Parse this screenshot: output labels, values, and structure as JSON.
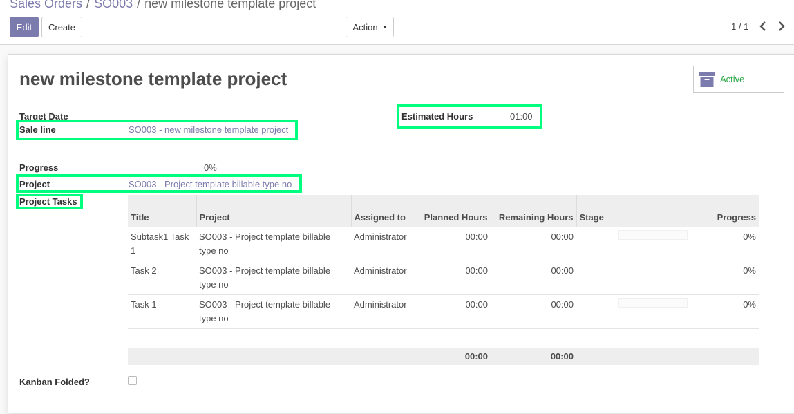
{
  "breadcrumb": {
    "items": [
      "Sales Orders",
      "SO003",
      "new milestone template project"
    ],
    "separator": "/"
  },
  "toolbar": {
    "edit_label": "Edit",
    "create_label": "Create",
    "action_label": "Action",
    "pager": "1 / 1"
  },
  "record": {
    "title": "new milestone template project",
    "status_button": "Active",
    "target_date_label": "Target Date",
    "sale_line_label": "Sale line",
    "sale_line_value": "SO003 - new milestone template project",
    "estimated_hours_label": "Estimated Hours",
    "estimated_hours_value": "01:00",
    "progress_label": "Progress",
    "progress_value": "0%",
    "project_label": "Project",
    "project_value": "SO003 - Project template billable type no",
    "project_tasks_label": "Project Tasks",
    "kanban_folded_label": "Kanban Folded?",
    "kanban_folded_checked": false
  },
  "tasks_table": {
    "headers": {
      "title": "Title",
      "project": "Project",
      "assigned_to": "Assigned to",
      "planned_hours": "Planned Hours",
      "remaining_hours": "Remaining Hours",
      "stage": "Stage",
      "progress": "Progress"
    },
    "rows": [
      {
        "title": "Subtask1 Task 1",
        "project": "SO003 - Project template billable type no",
        "assigned_to": "Administrator",
        "planned_hours": "00:00",
        "remaining_hours": "00:00",
        "stage": "",
        "progress": "0%"
      },
      {
        "title": "Task 2",
        "project": "SO003 - Project template billable type no",
        "assigned_to": "Administrator",
        "planned_hours": "00:00",
        "remaining_hours": "00:00",
        "stage": "",
        "progress": "0%"
      },
      {
        "title": "Task 1",
        "project": "SO003 - Project template billable type no",
        "assigned_to": "Administrator",
        "planned_hours": "00:00",
        "remaining_hours": "00:00",
        "stage": "",
        "progress": "0%"
      }
    ],
    "totals": {
      "planned_hours": "00:00",
      "remaining_hours": "00:00"
    }
  },
  "colors": {
    "brand": "#7c7bad",
    "active_green": "#28a745",
    "highlight": "#00ff7f"
  },
  "icons": {
    "archive": "archive-icon",
    "prev": "chevron-left-icon",
    "next": "chevron-right-icon",
    "caret": "caret-down-icon"
  }
}
